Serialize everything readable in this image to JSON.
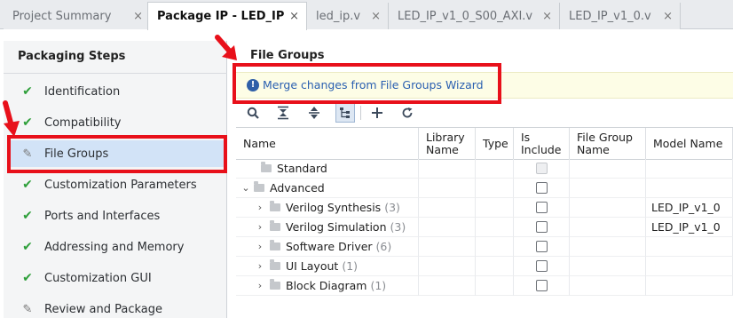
{
  "tabs": [
    {
      "label": "Project Summary",
      "active": false
    },
    {
      "label": "Package IP - LED_IP",
      "active": true
    },
    {
      "label": "led_ip.v",
      "active": false
    },
    {
      "label": "LED_IP_v1_0_S00_AXI.v",
      "active": false
    },
    {
      "label": "LED_IP_v1_0.v",
      "active": false
    }
  ],
  "close_glyph": "×",
  "left_panel": {
    "title": "Packaging Steps",
    "steps": [
      {
        "label": "Identification",
        "icon": "check-icon"
      },
      {
        "label": "Compatibility",
        "icon": "check-icon"
      },
      {
        "label": "File Groups",
        "icon": "edit-icon",
        "selected": true
      },
      {
        "label": "Customization Parameters",
        "icon": "check-icon"
      },
      {
        "label": "Ports and Interfaces",
        "icon": "check-icon"
      },
      {
        "label": "Addressing and Memory",
        "icon": "check-icon"
      },
      {
        "label": "Customization GUI",
        "icon": "check-icon"
      },
      {
        "label": "Review and Package",
        "icon": "edit-icon"
      }
    ]
  },
  "file_groups": {
    "title": "File Groups",
    "banner_link": "Merge changes from File Groups Wizard",
    "toolbar": [
      "search-icon",
      "collapse-all-icon",
      "expand-all-icon",
      "hierarchy-icon",
      "add-icon",
      "refresh-icon"
    ],
    "columns": [
      "Name",
      "Library\nName",
      "Type",
      "Is\nInclude",
      "File Group\nName",
      "Model Name"
    ],
    "rows": [
      {
        "name": "Standard",
        "count": "",
        "level": 1,
        "expander": "",
        "include": "disabled",
        "model": ""
      },
      {
        "name": "Advanced",
        "count": "",
        "level": 0,
        "expander": "⌄",
        "include": "empty",
        "model": ""
      },
      {
        "name": "Verilog Synthesis",
        "count": "(3)",
        "level": 1,
        "expander": "›",
        "include": "empty",
        "model": "LED_IP_v1_0"
      },
      {
        "name": "Verilog Simulation",
        "count": "(3)",
        "level": 1,
        "expander": "›",
        "include": "empty",
        "model": "LED_IP_v1_0"
      },
      {
        "name": "Software Driver",
        "count": "(6)",
        "level": 1,
        "expander": "›",
        "include": "empty",
        "model": ""
      },
      {
        "name": "UI Layout",
        "count": "(1)",
        "level": 1,
        "expander": "›",
        "include": "empty",
        "model": ""
      },
      {
        "name": "Block Diagram",
        "count": "(1)",
        "level": 1,
        "expander": "›",
        "include": "empty",
        "model": ""
      }
    ]
  },
  "colors": {
    "annotation_red": "#e8101a",
    "check_green": "#2e9f3a",
    "link_blue": "#2a5fb0",
    "selection_blue": "#d2e3f7"
  }
}
